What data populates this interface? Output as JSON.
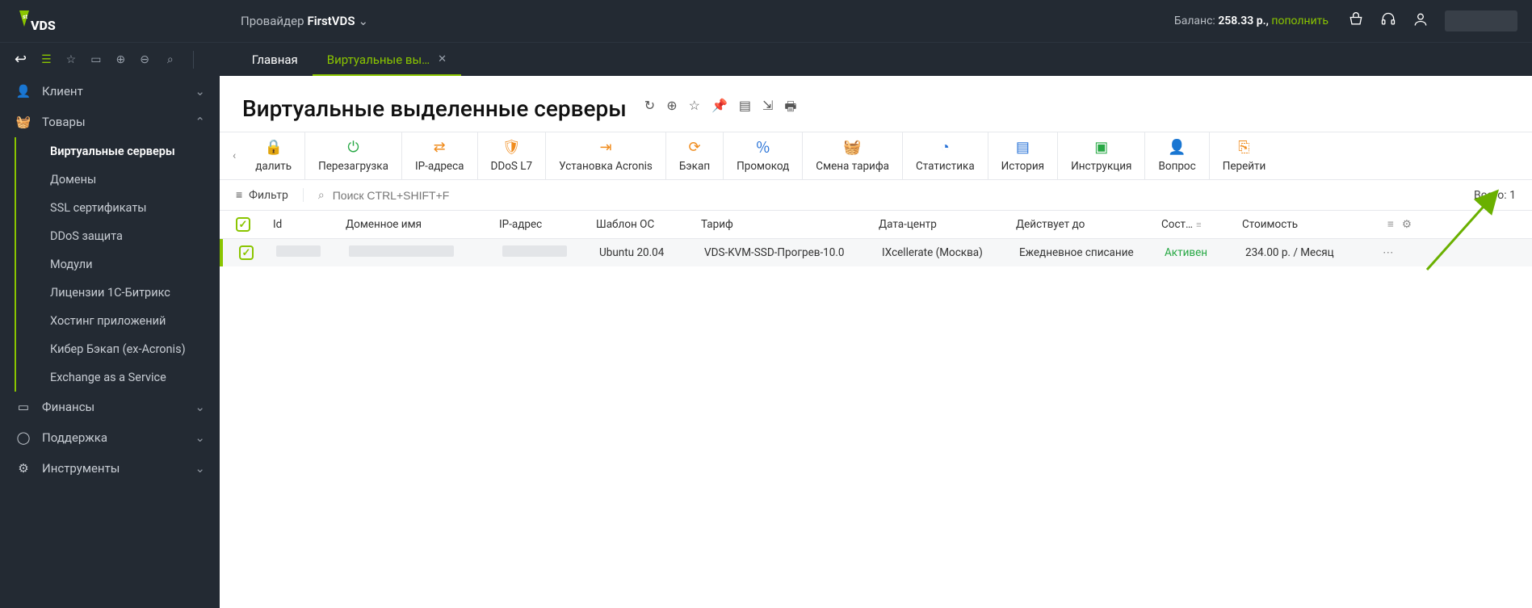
{
  "header": {
    "provider_label": "Провайдер",
    "provider_name": "FirstVDS",
    "balance_label": "Баланс:",
    "balance_value": "258.33 р.,",
    "topup": "пополнить"
  },
  "tabs": [
    {
      "label": "Главная",
      "active": false,
      "closable": false
    },
    {
      "label": "Виртуальные вы…",
      "active": true,
      "closable": true
    }
  ],
  "sidebar": {
    "groups": [
      {
        "label": "Клиент",
        "icon": "user",
        "open": false
      },
      {
        "label": "Товары",
        "icon": "basket",
        "open": true,
        "items": [
          {
            "label": "Виртуальные серверы",
            "active": true
          },
          {
            "label": "Домены"
          },
          {
            "label": "SSL сертификаты"
          },
          {
            "label": "DDoS защита"
          },
          {
            "label": "Модули"
          },
          {
            "label": "Лицензии 1С-Битрикс"
          },
          {
            "label": "Хостинг приложений"
          },
          {
            "label": "Кибер Бэкап (ex-Acronis)"
          },
          {
            "label": "Exchange as a Service"
          }
        ]
      },
      {
        "label": "Финансы",
        "icon": "wallet",
        "open": false
      },
      {
        "label": "Поддержка",
        "icon": "headset",
        "open": false
      },
      {
        "label": "Инструменты",
        "icon": "gear",
        "open": false
      }
    ]
  },
  "page": {
    "title": "Виртуальные выделенные серверы"
  },
  "toolbar": [
    {
      "label": "далить",
      "color": "c-gray",
      "name": "delete"
    },
    {
      "label": "Перезагрузка",
      "color": "c-green",
      "name": "reboot"
    },
    {
      "label": "IP-адреса",
      "color": "c-orange",
      "name": "ip"
    },
    {
      "label": "DDoS L7",
      "color": "c-orange",
      "name": "ddos"
    },
    {
      "label": "Установка Acronis",
      "color": "c-orange",
      "name": "acronis"
    },
    {
      "label": "Бэкап",
      "color": "c-orange",
      "name": "backup"
    },
    {
      "label": "Промокод",
      "color": "c-blue",
      "name": "promo"
    },
    {
      "label": "Смена тарифа",
      "color": "c-blue",
      "name": "tariff"
    },
    {
      "label": "Статистика",
      "color": "c-blue",
      "name": "stats"
    },
    {
      "label": "История",
      "color": "c-blue",
      "name": "history"
    },
    {
      "label": "Инструкция",
      "color": "c-green",
      "name": "instr"
    },
    {
      "label": "Вопрос",
      "color": "c-orange",
      "name": "question"
    },
    {
      "label": "Перейти",
      "color": "c-orange",
      "name": "goto"
    }
  ],
  "filter": {
    "label": "Фильтр",
    "search_placeholder": "Поиск CTRL+SHIFT+F",
    "total_label": "Всего:",
    "total_value": "1"
  },
  "table": {
    "columns": [
      "Id",
      "Доменное имя",
      "IP-адрес",
      "Шаблон ОС",
      "Тариф",
      "Дата-центр",
      "Действует до",
      "Сост…",
      "Стоимость"
    ],
    "row": {
      "os": "Ubuntu 20.04",
      "tariff": "VDS-KVM-SSD-Прогрев-10.0",
      "dc": "IXcellerate (Москва)",
      "expires": "Ежедневное списание",
      "status": "Активен",
      "cost": "234.00 р. / Месяц"
    }
  },
  "colors": {
    "accent": "#8ac500"
  }
}
